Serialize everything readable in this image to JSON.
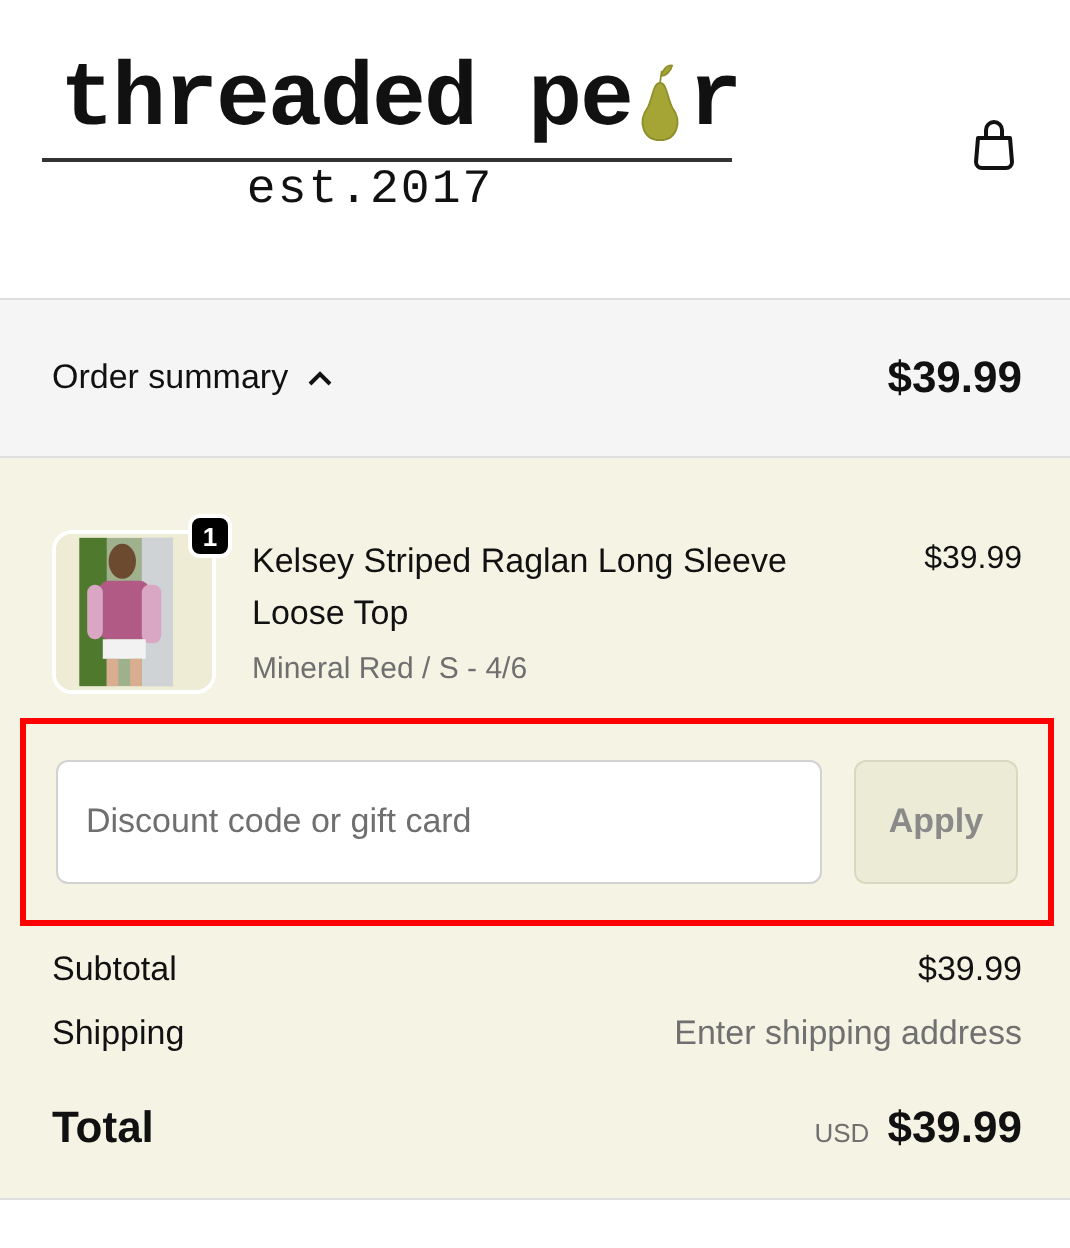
{
  "header": {
    "logo": {
      "text_before": "threaded pe",
      "text_after": "r",
      "tagline": "est.2017"
    }
  },
  "summary_bar": {
    "label": "Order summary",
    "expanded": true,
    "total": "$39.99"
  },
  "items": [
    {
      "quantity": "1",
      "name": "Kelsey Striped Raglan Long Sleeve Loose Top",
      "variant": "Mineral Red / S - 4/6",
      "price": "$39.99"
    }
  ],
  "discount": {
    "placeholder": "Discount code or gift card",
    "button": "Apply",
    "disabled": true,
    "highlighted": true
  },
  "lines": [
    {
      "label": "Subtotal",
      "value": "$39.99",
      "muted": false
    },
    {
      "label": "Shipping",
      "value": "Enter shipping address",
      "muted": true
    }
  ],
  "total": {
    "label": "Total",
    "currency": "USD",
    "amount": "$39.99"
  }
}
